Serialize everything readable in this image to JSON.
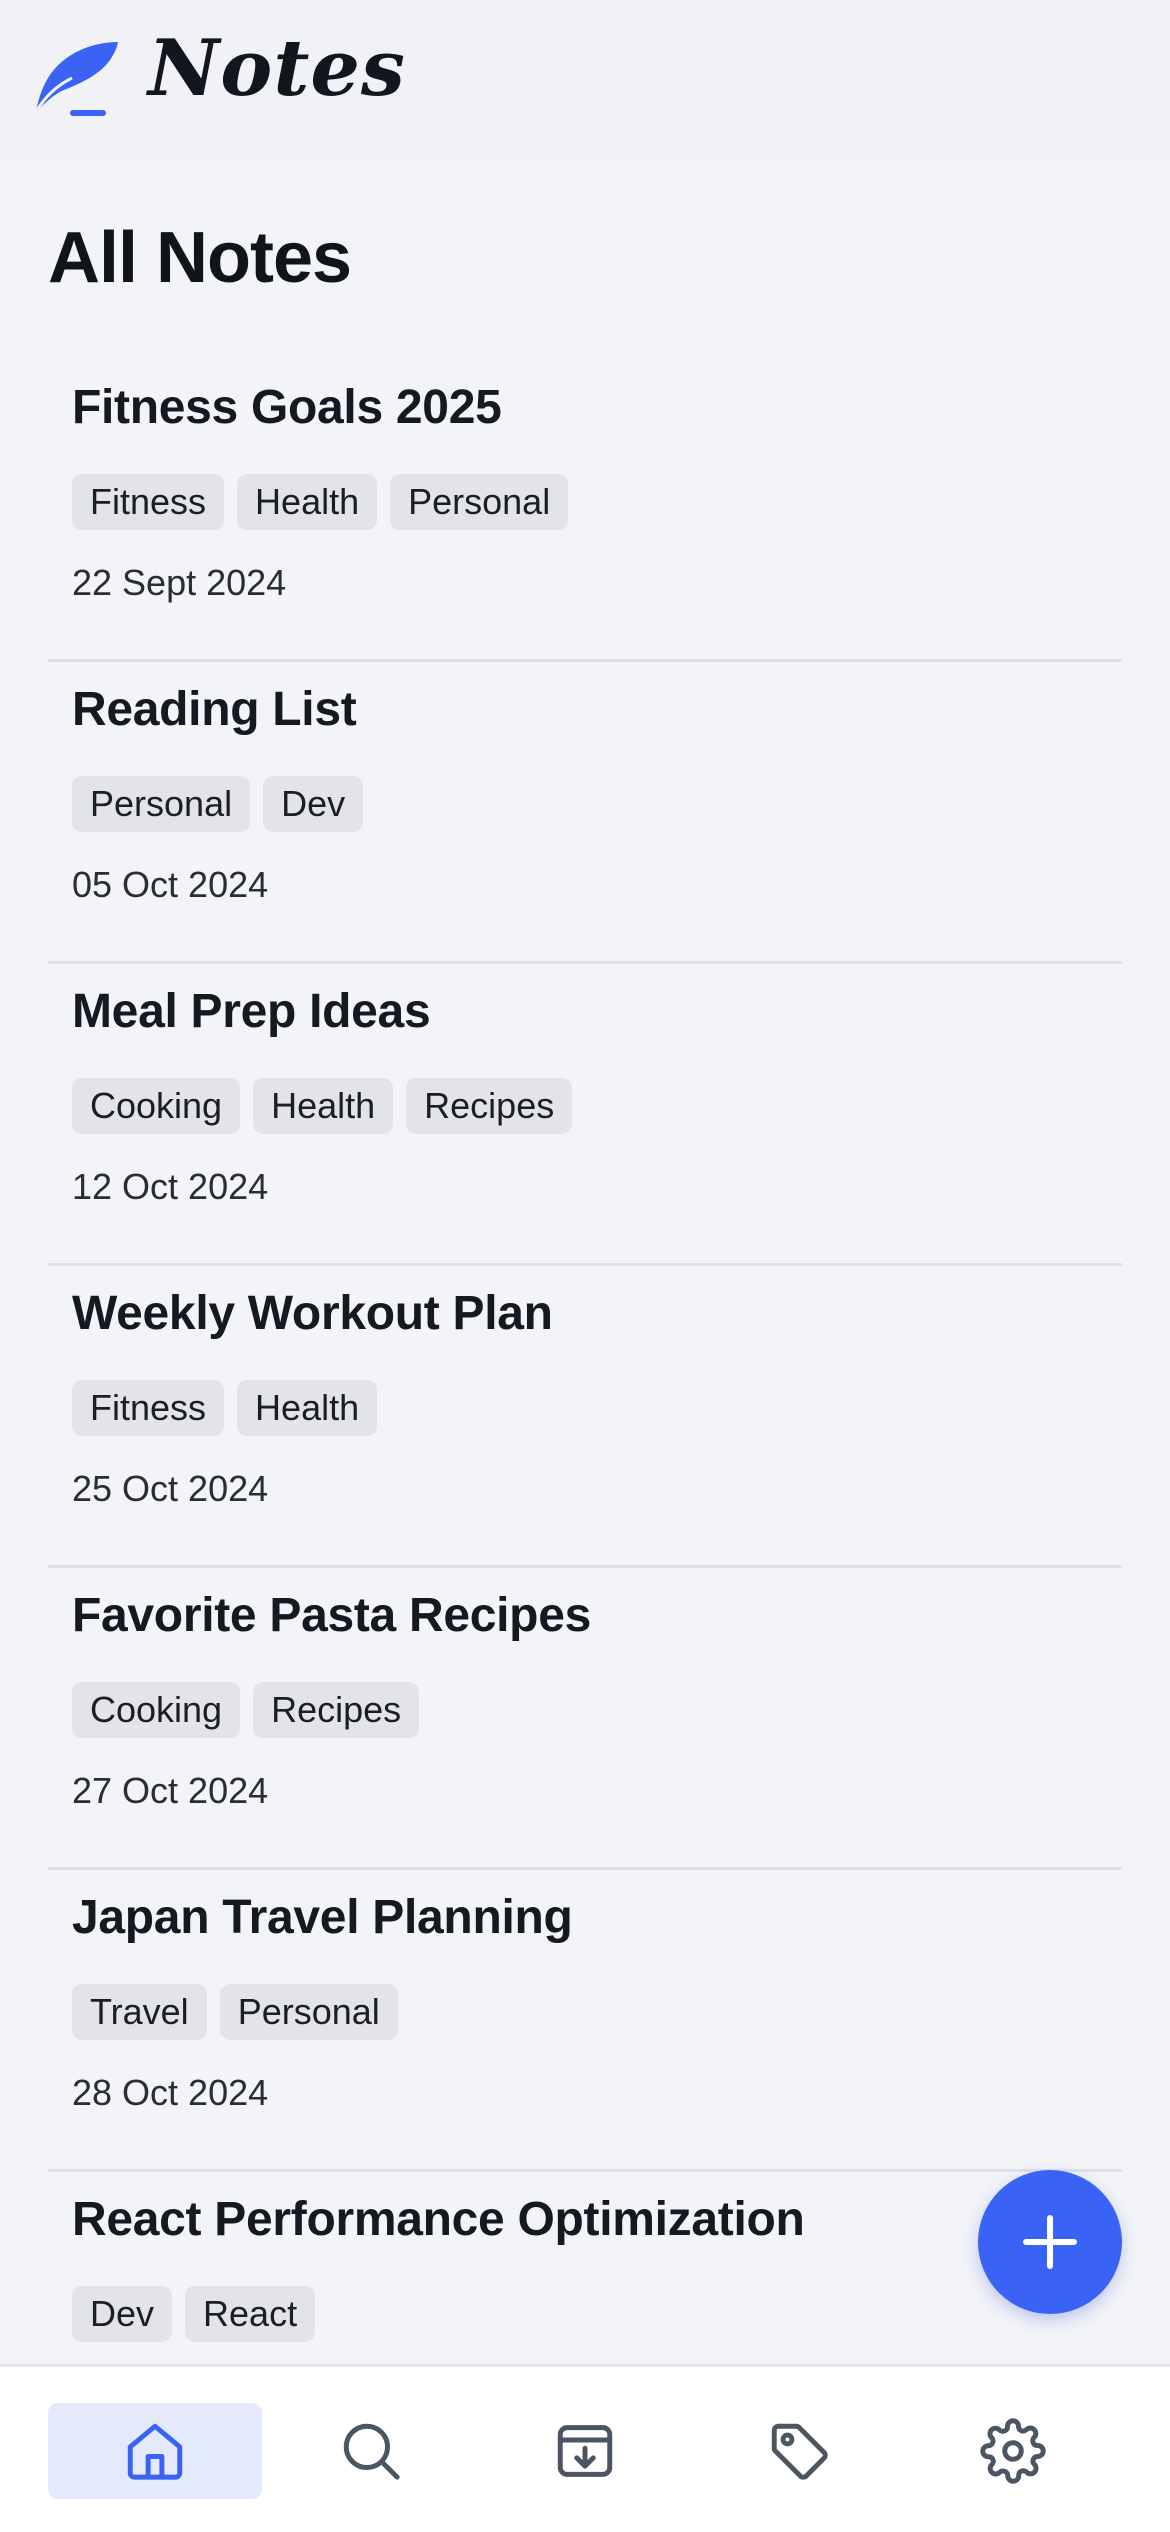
{
  "app": {
    "name": "Notes"
  },
  "page": {
    "title": "All Notes"
  },
  "notes": [
    {
      "title": "Fitness Goals 2025",
      "tags": [
        "Fitness",
        "Health",
        "Personal"
      ],
      "date": "22 Sept 2024"
    },
    {
      "title": "Reading List",
      "tags": [
        "Personal",
        "Dev"
      ],
      "date": "05 Oct 2024"
    },
    {
      "title": "Meal Prep Ideas",
      "tags": [
        "Cooking",
        "Health",
        "Recipes"
      ],
      "date": "12 Oct 2024"
    },
    {
      "title": "Weekly Workout Plan",
      "tags": [
        "Fitness",
        "Health"
      ],
      "date": "25 Oct 2024"
    },
    {
      "title": "Favorite Pasta Recipes",
      "tags": [
        "Cooking",
        "Recipes"
      ],
      "date": "27 Oct 2024"
    },
    {
      "title": "Japan Travel Planning",
      "tags": [
        "Travel",
        "Personal"
      ],
      "date": "28 Oct 2024"
    },
    {
      "title": "React Performance Optimization",
      "tags": [
        "Dev",
        "React"
      ],
      "date": ""
    }
  ],
  "fab": {
    "icon": "plus-icon"
  },
  "bottom_nav": {
    "items": [
      {
        "icon": "home-icon",
        "active": true
      },
      {
        "icon": "search-icon",
        "active": false
      },
      {
        "icon": "archive-icon",
        "active": false
      },
      {
        "icon": "tag-icon",
        "active": false
      },
      {
        "icon": "settings-icon",
        "active": false
      }
    ]
  },
  "colors": {
    "accent": "#3a62f5",
    "background": "#f3f4f8",
    "tag_background": "#e2e4e8",
    "nav_active_background": "#e4eafb",
    "nav_icon": "#4b5563"
  }
}
